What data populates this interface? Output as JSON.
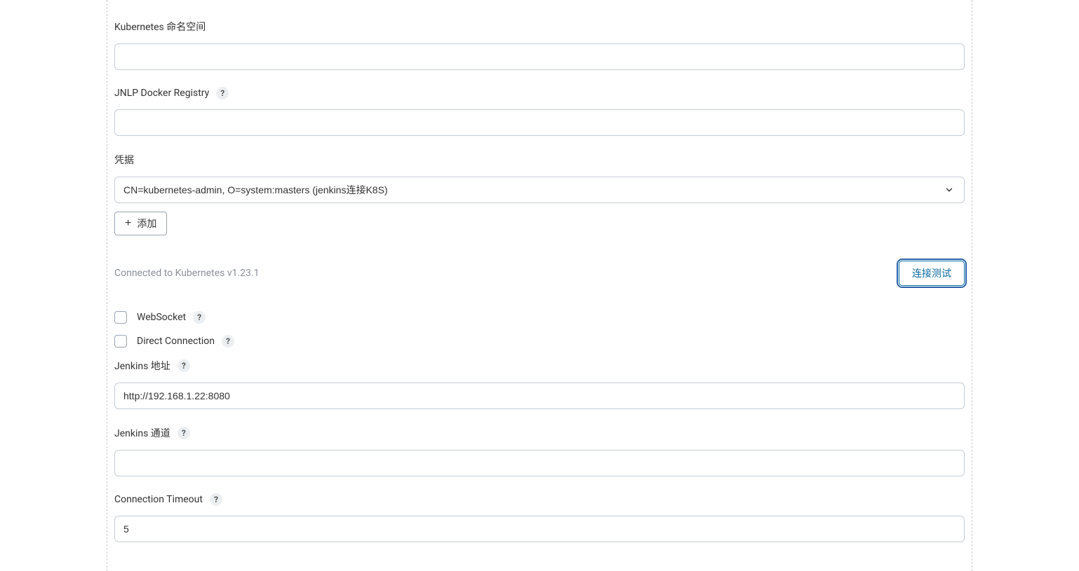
{
  "fields": {
    "namespace": {
      "label": "Kubernetes 命名空间",
      "value": ""
    },
    "jnlp_registry": {
      "label": "JNLP Docker Registry",
      "value": ""
    },
    "credentials": {
      "label": "凭据",
      "selected": "CN=kubernetes-admin, O=system:masters (jenkins连接K8S)"
    },
    "jenkins_url": {
      "label": "Jenkins 地址",
      "value": "http://192.168.1.22:8080"
    },
    "jenkins_tunnel": {
      "label": "Jenkins 通道",
      "value": ""
    },
    "connection_timeout": {
      "label": "Connection Timeout",
      "value": "5"
    }
  },
  "checkboxes": {
    "websocket": {
      "label": "WebSocket"
    },
    "direct_connection": {
      "label": "Direct Connection"
    }
  },
  "buttons": {
    "add": "添加",
    "test_connection": "连接测试"
  },
  "status": {
    "connected": "Connected to Kubernetes v1.23.1"
  },
  "help_char": "?"
}
